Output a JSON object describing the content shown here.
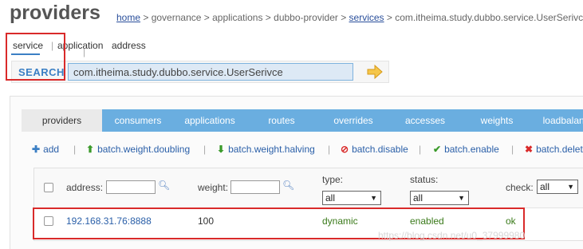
{
  "page": {
    "title": "providers"
  },
  "breadcrumb": {
    "home": "home",
    "middle": " > governance > applications > dubbo-provider > ",
    "services": "services",
    "tail": " > com.itheima.study.dubbo.service.UserSerivce"
  },
  "search": {
    "tabs": {
      "service": "service",
      "sep": "|",
      "application": "application",
      "address": "address"
    },
    "label": "SEARCH",
    "value": "com.itheima.study.dubbo.service.UserSerivce"
  },
  "nav": {
    "tabs": [
      "providers",
      "consumers",
      "applications",
      "routes",
      "overrides",
      "accesses",
      "weights",
      "loadbalance"
    ],
    "active": "providers"
  },
  "toolbar": {
    "add": "add",
    "doubling": "batch.weight.doubling",
    "halving": "batch.weight.halving",
    "disable": "batch.disable",
    "enable": "batch.enable",
    "delete": "batch.delete",
    "sep": "|"
  },
  "table": {
    "address_label": "address:",
    "weight_label": "weight:",
    "type_label": "type:",
    "status_label": "status:",
    "check_label": "check:",
    "type_filter": "all",
    "status_filter": "all",
    "check_filter": "all",
    "rows": [
      {
        "address": "192.168.31.76:8888",
        "weight": "100",
        "type": "dynamic",
        "status": "enabled",
        "check": "ok"
      }
    ]
  },
  "watermark": "https://blog.csdn.net/u0_37999980",
  "colors": {
    "accent": "#3b7fc4",
    "nav": "#6aaee0",
    "highlight": "#d92a2a",
    "ok": "#3a7a1a"
  },
  "icons": [
    "search-arrow-icon",
    "plus-icon",
    "up-arrow-icon",
    "down-arrow-icon",
    "no-icon",
    "check-icon",
    "x-icon",
    "magnifier-icon"
  ]
}
